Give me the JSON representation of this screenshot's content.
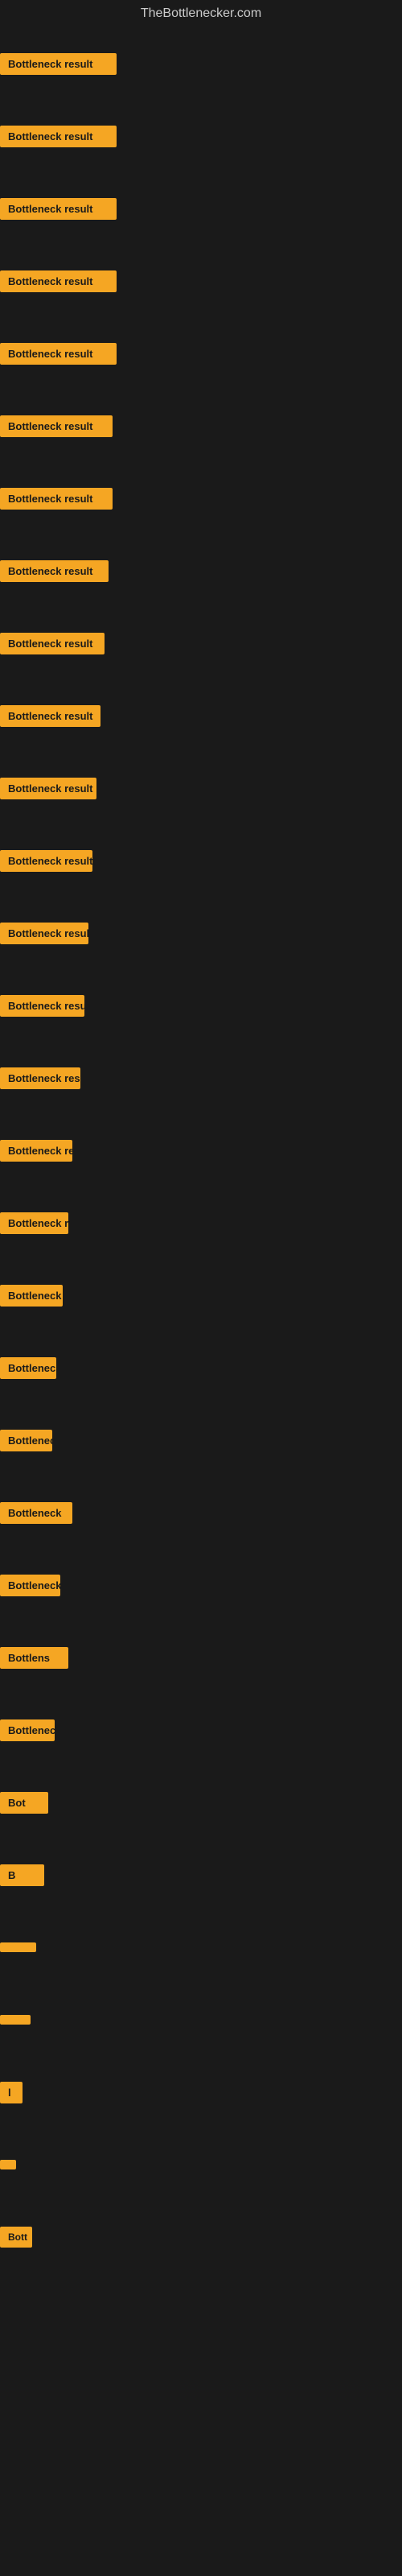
{
  "site": {
    "title": "TheBottlenecker.com"
  },
  "items": [
    {
      "id": 1,
      "label": "Bottleneck result"
    },
    {
      "id": 2,
      "label": "Bottleneck result"
    },
    {
      "id": 3,
      "label": "Bottleneck result"
    },
    {
      "id": 4,
      "label": "Bottleneck result"
    },
    {
      "id": 5,
      "label": "Bottleneck result"
    },
    {
      "id": 6,
      "label": "Bottleneck result"
    },
    {
      "id": 7,
      "label": "Bottleneck result"
    },
    {
      "id": 8,
      "label": "Bottleneck result"
    },
    {
      "id": 9,
      "label": "Bottleneck result"
    },
    {
      "id": 10,
      "label": "Bottleneck result"
    },
    {
      "id": 11,
      "label": "Bottleneck result"
    },
    {
      "id": 12,
      "label": "Bottleneck result"
    },
    {
      "id": 13,
      "label": "Bottleneck result"
    },
    {
      "id": 14,
      "label": "Bottleneck result"
    },
    {
      "id": 15,
      "label": "Bottleneck result"
    },
    {
      "id": 16,
      "label": "Bottleneck re"
    },
    {
      "id": 17,
      "label": "Bottleneck result"
    },
    {
      "id": 18,
      "label": "Bottleneck r"
    },
    {
      "id": 19,
      "label": "Bottlenec"
    },
    {
      "id": 20,
      "label": "Bottleneck r"
    },
    {
      "id": 21,
      "label": "Bottleneck"
    },
    {
      "id": 22,
      "label": "Bottleneck res"
    },
    {
      "id": 23,
      "label": "Bottlens"
    },
    {
      "id": 24,
      "label": "Bottleneck"
    },
    {
      "id": 25,
      "label": "Bot"
    },
    {
      "id": 26,
      "label": "B"
    },
    {
      "id": 27,
      "label": ""
    },
    {
      "id": 28,
      "label": ""
    },
    {
      "id": 29,
      "label": "l"
    },
    {
      "id": 30,
      "label": ""
    },
    {
      "id": 31,
      "label": "Bott"
    }
  ]
}
